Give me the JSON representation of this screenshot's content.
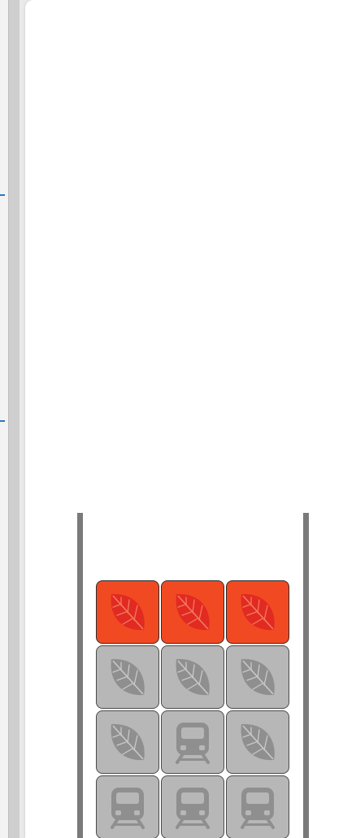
{
  "colors": {
    "active_tile": "#f14a22",
    "inactive_tile": "#b7b7b7",
    "leaf_active": "#e12a22",
    "icon_inactive": "#8f8f8f",
    "wall": "#7a7a7a",
    "panel": "#ffffff",
    "link_mark": "#2f74c0"
  },
  "grid": {
    "columns": 3,
    "rows": [
      [
        {
          "icon": "leaf-icon",
          "state": "active"
        },
        {
          "icon": "leaf-icon",
          "state": "active"
        },
        {
          "icon": "leaf-icon",
          "state": "active"
        }
      ],
      [
        {
          "icon": "leaf-icon",
          "state": "inactive"
        },
        {
          "icon": "leaf-icon",
          "state": "inactive"
        },
        {
          "icon": "leaf-icon",
          "state": "inactive"
        }
      ],
      [
        {
          "icon": "leaf-icon",
          "state": "inactive"
        },
        {
          "icon": "train-icon",
          "state": "inactive"
        },
        {
          "icon": "leaf-icon",
          "state": "inactive"
        }
      ],
      [
        {
          "icon": "train-icon",
          "state": "inactive"
        },
        {
          "icon": "train-icon",
          "state": "inactive"
        },
        {
          "icon": "train-icon",
          "state": "inactive"
        }
      ]
    ]
  }
}
